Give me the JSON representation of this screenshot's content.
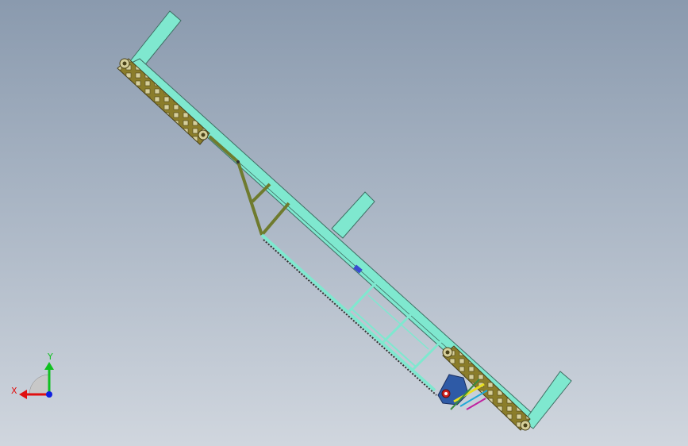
{
  "triad": {
    "x_label": "X",
    "y_label": "Y"
  },
  "colors": {
    "background_top": "#8a9aae",
    "background_bottom": "#d0d6de",
    "frame": "#7fe8cf",
    "frame_edge": "#3f6f64",
    "chain": "#8b7d2a",
    "chain_edge": "#4a421a",
    "truss": "#6f7b2e",
    "motor": "#2e5aa6",
    "x_axis": "#e01010",
    "y_axis": "#10c020",
    "z_axis": "#1020e0"
  }
}
